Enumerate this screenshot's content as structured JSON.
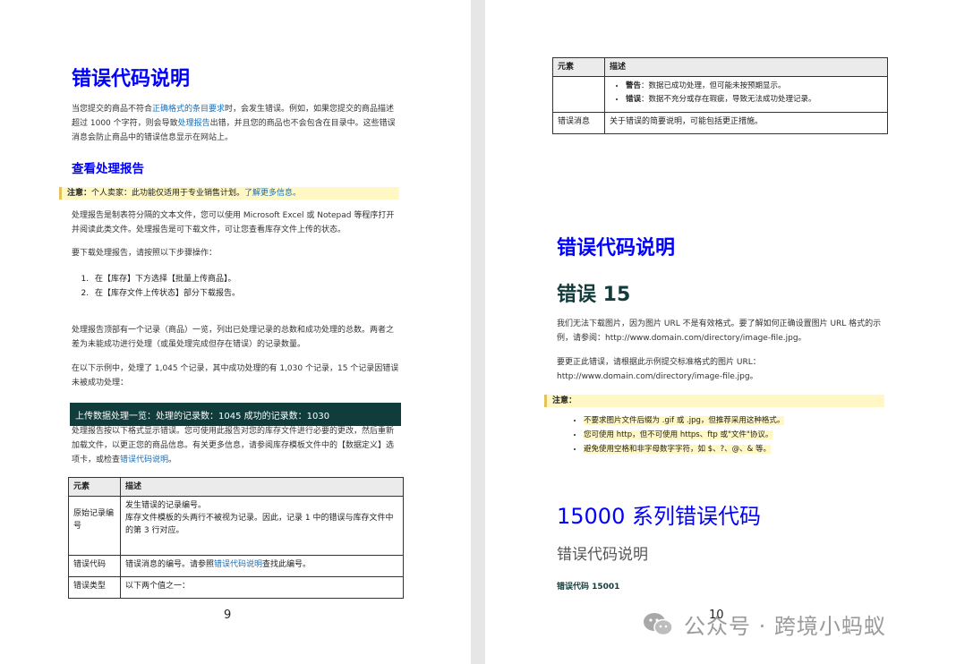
{
  "left": {
    "title": "错误代码说明",
    "intro": {
      "t1": "当您提交的商品不符合",
      "link1": "正确格式的条目要求",
      "t2": "时，会发生错误。例如，如果您提交的商品描述超过 1000 个字符，则会导致",
      "link2": "处理报告",
      "t3": "出错，并且您的商品也不会包含在目录中。这些错误消息会防止商品中的错误信息显示在网站上。"
    },
    "section_title": "查看处理报告",
    "note": {
      "label": "注意：",
      "text": "个人卖家：此功能仅适用于专业销售计划。",
      "link": "了解更多信息。"
    },
    "para1": "处理报告是制表符分隔的文本文件，您可以使用 Microsoft Excel 或 Notepad 等程序打开并阅读此类文件。处理报告是可下载文件，可让您查看库存文件上传的状态。",
    "para2": "要下载处理报告，请按照以下步骤操作：",
    "steps": [
      "在【库存】下方选择【批量上传商品】。",
      "在【库存文件上传状态】部分下载报告。"
    ],
    "para3": "处理报告顶部有一个记录（商品）一览，列出已处理记录的总数和成功处理的总数。两者之差为未能成功进行处理（或虽处理完成但存在错误）的记录数量。",
    "para4": "在以下示例中，处理了 1,045 个记录，其中成功处理的有 1,030 个记录，15 个记录因错误未被成功处理：",
    "banner": "上传数据处理一览：处理的记录数：1045 成功的记录数：1030",
    "para5": {
      "t1": "处理报告按以下格式显示错误。您可使用此报告对您的库存文件进行必要的更改，然后重新加载文件，以更正您的商品信息。有关更多信息，请参阅库存模板文件中的【数据定义】选项卡，或检查",
      "link": "错误代码说明",
      "t2": "。"
    },
    "table": {
      "headers": [
        "元素",
        "描述"
      ],
      "row1": {
        "c1": "原始记录编号",
        "c2a": "发生错误的记录编号。",
        "c2b": "库存文件模板的头两行不被视为记录。因此，记录 1 中的错误与库存文件中的第 3 行对应。"
      },
      "row2": {
        "c1": "错误代码",
        "t1": "错误消息的编号。请参照",
        "link": "错误代码说明",
        "t2": "查找此编号。"
      },
      "row3": {
        "c1": "错误类型",
        "c2": "以下两个值之一："
      }
    },
    "page_number": "9"
  },
  "right": {
    "table": {
      "headers": [
        "元素",
        "描述"
      ],
      "bullets": [
        {
          "label": "警告",
          "text": "：数据已成功处理，但可能未按预期显示。"
        },
        {
          "label": "错误",
          "text": "：数据不充分或存在瑕疵，导致无法成功处理记录。"
        }
      ],
      "row_msg": {
        "c1": "错误消息",
        "c2": "关于错误的简要说明，可能包括更正措施。"
      }
    },
    "title": "错误代码说明",
    "error_title": "错误 15",
    "para1": "我们无法下载图片，因为图片 URL 不是有效格式。要了解如何正确设置图片 URL 格式的示例，请参阅：http://www.domain.com/directory/image-file.jpg。",
    "para2": "要更正此错误，请根据此示例提交标准格式的图片 URL：http://www.domain.com/directory/image-file.jpg。",
    "note_label": "注意：",
    "note_items": [
      "不要求图片文件后缀为 .gif 或 .jpg，但推荐采用这种格式。",
      "您可使用 http，但不可使用 https、ftp 或\"文件\"协议。",
      "避免使用空格和非字母数字字符，如 $、?、@、& 等。"
    ],
    "series_title": "15000 系列错误代码",
    "sub_title": "错误代码说明",
    "code_label": "错误代码 15001",
    "page_number": "10"
  },
  "watermark": "公众号 · 跨境小蚂蚁"
}
